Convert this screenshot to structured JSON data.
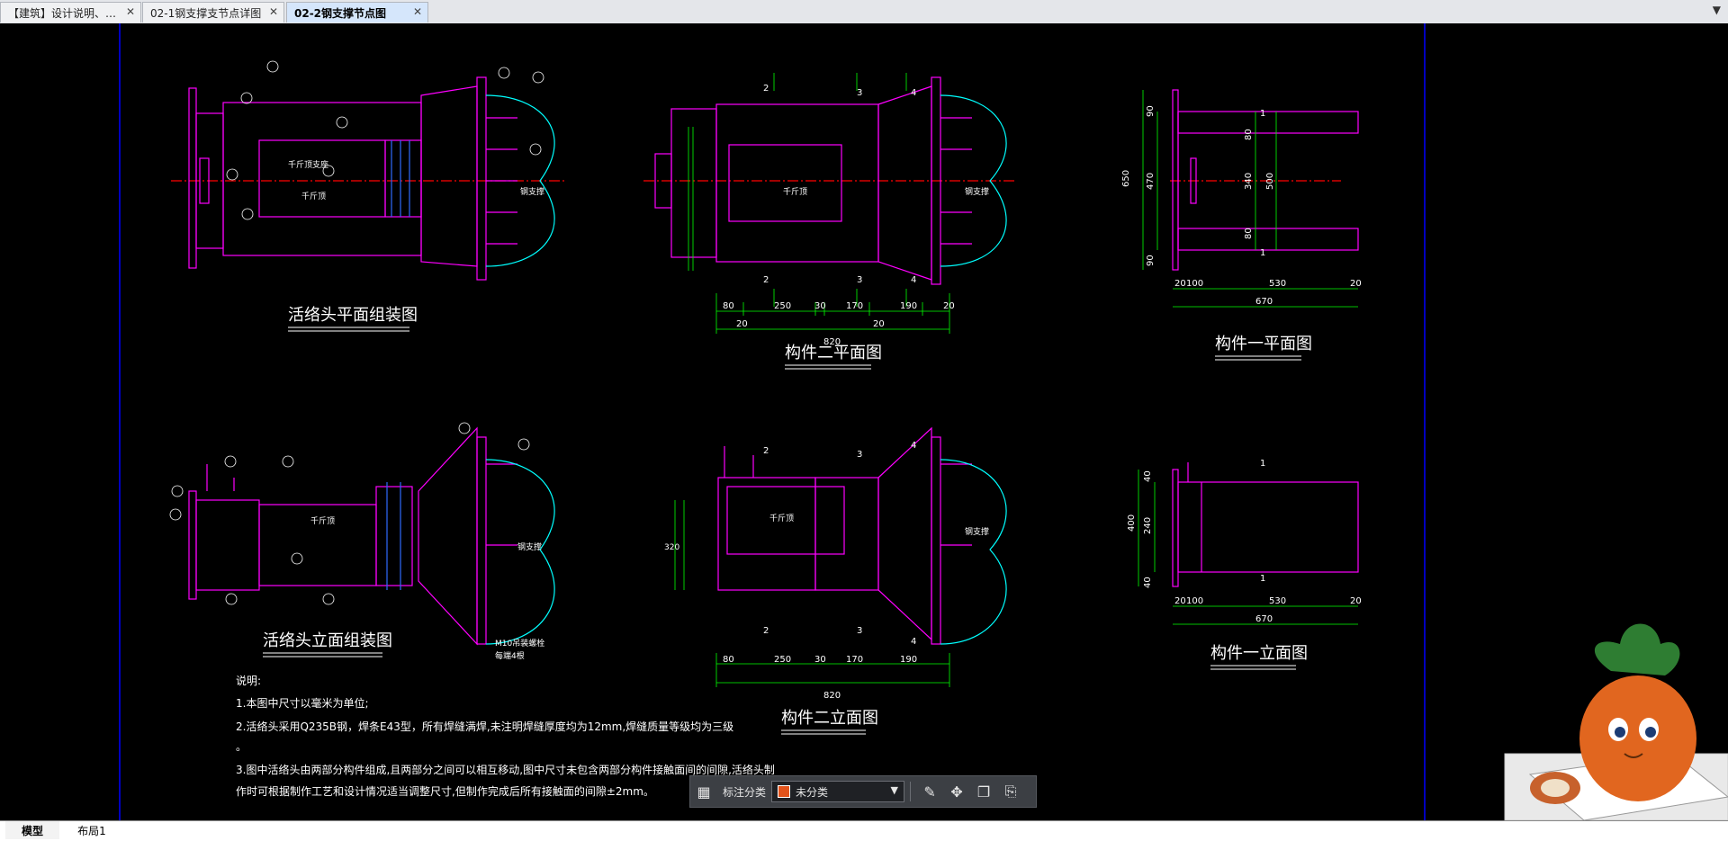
{
  "tabs": [
    {
      "label": "【建筑】设计说明、…",
      "active": false
    },
    {
      "label": "02-1钢支撑支节点详图",
      "active": false
    },
    {
      "label": "02-2钢支撑节点图",
      "active": true
    }
  ],
  "drawing": {
    "titles": {
      "plan_assembly": "活络头平面组装图",
      "elev_assembly": "活络头立面组装图",
      "part2_plan": "构件二平面图",
      "part2_elev": "构件二立面图",
      "part1_plan": "构件一平面图",
      "part1_elev": "构件一立面图"
    },
    "labels": {
      "jack": "千斤顶",
      "steel_pipe": "钢支撑",
      "jack_base": "千斤顶支座",
      "bolt_note": "M10吊装螺栓",
      "small": "每端4根",
      "section2": "2",
      "section3": "3",
      "section4": "4",
      "section1": "1"
    },
    "dims": {
      "d80": "80",
      "d250": "250",
      "d30": "30",
      "d170": "170",
      "d190": "190",
      "d20": "20",
      "d820": "820",
      "d90": "90",
      "d650": "650",
      "d470": "470",
      "d340": "340",
      "d500": "500",
      "d100": "100",
      "d530": "530",
      "d670": "670",
      "d40": "40",
      "d400": "400",
      "d240": "240",
      "d320": "320"
    },
    "notes": {
      "heading": "说明:",
      "n1": "1.本图中尺寸以毫米为单位;",
      "n2": "2.活络头采用Q235B钢，焊条E43型，所有焊缝满焊,未注明焊缝厚度均为12mm,焊缝质量等级均为三级",
      "n2b": "。",
      "n3": "3.图中活络头由两部分构件组成,且两部分之间可以相互移动,图中尺寸未包含两部分构件接触面间的间隙,活络头制",
      "n3b": "作时可根据制作工艺和设计情况适当调整尺寸,但制作完成后所有接触面的间隙±2mm。"
    }
  },
  "toolbar": {
    "label": "标注分类",
    "category": "未分类",
    "swatch_color": "#e2531b"
  },
  "layout_tabs": [
    {
      "label": "模型",
      "active": true
    },
    {
      "label": "布局1",
      "active": false
    }
  ],
  "colors": {
    "magenta": "#ff00ff",
    "cyan": "#00ffff",
    "green": "#00ff00",
    "white": "#ffffff",
    "blue_border": "#0000ff",
    "red_center": "#ff0000"
  }
}
